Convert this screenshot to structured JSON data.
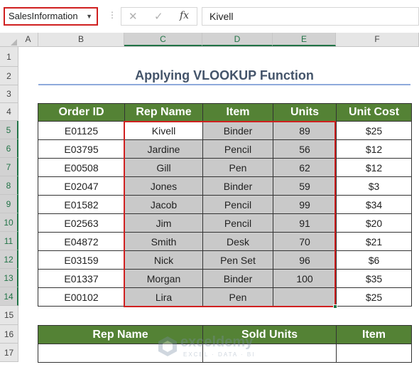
{
  "formula_bar": {
    "name_box": "SalesInformation",
    "cancel_icon": "✕",
    "enter_icon": "✓",
    "fx_label": "fx",
    "formula_value": "Kivell"
  },
  "columns": [
    "A",
    "B",
    "C",
    "D",
    "E",
    "F"
  ],
  "rows": [
    "1",
    "2",
    "3",
    "4",
    "5",
    "6",
    "7",
    "8",
    "9",
    "10",
    "11",
    "12",
    "13",
    "14",
    "15",
    "16",
    "17"
  ],
  "sheet": {
    "title": "Applying VLOOKUP Function",
    "table": {
      "headers": [
        "Order ID",
        "Rep Name",
        "Item",
        "Units",
        "Unit Cost"
      ],
      "rows": [
        [
          "E01125",
          "Kivell",
          "Binder",
          "89",
          "$25"
        ],
        [
          "E03795",
          "Jardine",
          "Pencil",
          "56",
          "$12"
        ],
        [
          "E00508",
          "Gill",
          "Pen",
          "62",
          "$12"
        ],
        [
          "E02047",
          "Jones",
          "Binder",
          "59",
          "$3"
        ],
        [
          "E01582",
          "Jacob",
          "Pencil",
          "99",
          "$34"
        ],
        [
          "E02563",
          "Jim",
          "Pencil",
          "91",
          "$20"
        ],
        [
          "E04872",
          "Smith",
          "Desk",
          "70",
          "$21"
        ],
        [
          "E03159",
          "Nick",
          "Pen Set",
          "96",
          "$6"
        ],
        [
          "E01337",
          "Morgan",
          "Binder",
          "100",
          "$35"
        ],
        [
          "E00102",
          "Lira",
          "Pen",
          "",
          "$25"
        ]
      ]
    },
    "lookup_table": {
      "headers": [
        "Rep Name",
        "Sold Units",
        "Item"
      ]
    }
  },
  "watermark": {
    "name": "exceldemy",
    "tagline": "EXCEL · DATA · BI"
  },
  "colors": {
    "header_green": "#548235",
    "selection_red": "#d02020",
    "selected_fill": "#c9c9c9",
    "title_color": "#44546a"
  }
}
